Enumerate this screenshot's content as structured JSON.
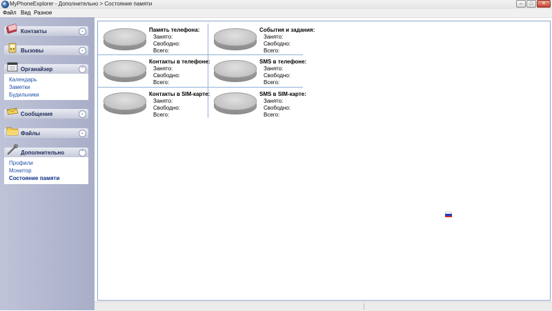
{
  "window": {
    "title": "MyPhoneExplorer -  Дополнительно > Состояние памяти",
    "buttons": [
      "–",
      "□",
      "✕"
    ]
  },
  "menu": [
    "Файл",
    "Вид",
    "Разное"
  ],
  "sidebar": {
    "groups": [
      {
        "label": "Контакты",
        "icon": "contacts-icon",
        "expanded": false,
        "items": []
      },
      {
        "label": "Вызовы",
        "icon": "calls-icon",
        "expanded": false,
        "items": []
      },
      {
        "label": "Органайзер",
        "icon": "organizer-icon",
        "expanded": true,
        "items": [
          "Календарь",
          "Заметки",
          "Будильники"
        ]
      },
      {
        "label": "Сообщения",
        "icon": "messages-icon",
        "expanded": false,
        "items": []
      },
      {
        "label": "Файлы",
        "icon": "files-icon",
        "expanded": false,
        "items": []
      },
      {
        "label": "Дополнительно",
        "icon": "extras-icon",
        "expanded": true,
        "items": [
          "Профили",
          "Монитор",
          "Состояние памяти"
        ],
        "active_item": "Состояние памяти"
      }
    ],
    "collapsed_glyph": "⌄",
    "expanded_glyph": "⌃"
  },
  "memory": {
    "cells": [
      {
        "title": "Память телефона:"
      },
      {
        "title": "События и задания:"
      },
      {
        "title": "Контакты в телефоне:"
      },
      {
        "title": "SMS в телефоне:"
      },
      {
        "title": "Контакты в SIM-карте:"
      },
      {
        "title": "SMS в SIM-карте:"
      }
    ],
    "labels": {
      "used": "Занято:",
      "free": "Свободно:",
      "total": "Всего:"
    }
  },
  "colors": {
    "link": "#1f50a8",
    "flag": [
      "#ffffff",
      "#1c3fbf",
      "#d52b1e"
    ]
  }
}
